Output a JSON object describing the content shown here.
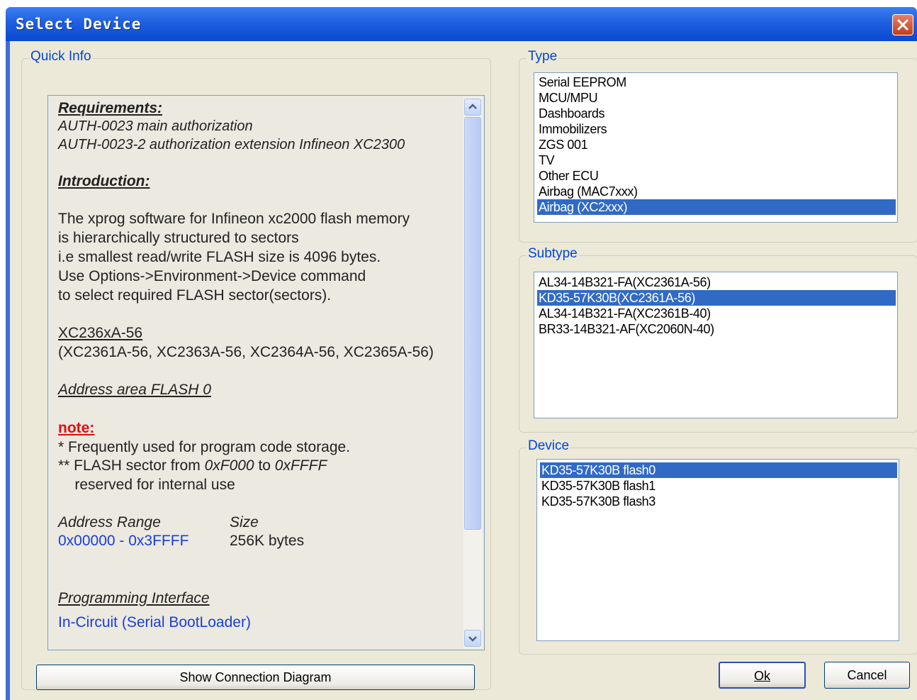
{
  "window": {
    "title": "Select Device"
  },
  "quick_info": {
    "group_label": "Quick Info",
    "requirements_heading": "Requirements:",
    "requirements": [
      "AUTH-0023  main authorization",
      "AUTH-0023-2 authorization extension Infineon XC2300"
    ],
    "introduction_heading": "Introduction:",
    "introduction_lines": [
      "The xprog software for Infineon xc2000 flash memory",
      "is hierarchically structured to sectors",
      "i.e smallest read/write FLASH size is 4096 bytes.",
      "Use Options->Environment->Device command",
      "to select required FLASH  sector(sectors)."
    ],
    "device_family": "XC236xA-56",
    "device_variants": "(XC2361A-56, XC2363A-56, XC2364A-56, XC2365A-56)",
    "address_area": "Address area FLASH 0",
    "note_label": "note:",
    "note_lines": [
      "* Frequently used for program code storage.",
      "** FLASH sector from ",
      "0xF000",
      " to ",
      "0xFFFF",
      "    reserved for internal use"
    ],
    "address_range_label": "Address Range",
    "size_label": "Size",
    "address_range_value": "0x00000 - 0x3FFFF",
    "size_value": "256K bytes",
    "programming_interface_label": "Programming Interface",
    "programming_interface_value": "In-Circuit (Serial BootLoader)"
  },
  "buttons": {
    "show_connection_diagram": "Show Connection Diagram",
    "ok": "Ok",
    "cancel": "Cancel"
  },
  "type": {
    "group_label": "Type",
    "items": [
      "Serial EEPROM",
      "MCU/MPU",
      "Dashboards",
      "Immobilizers",
      "ZGS 001",
      "TV",
      "Other ECU",
      "Airbag (MAC7xxx)",
      "Airbag (XC2xxx)"
    ],
    "selected_index": 8
  },
  "subtype": {
    "group_label": "Subtype",
    "items": [
      "AL34-14B321-FA(XC2361A-56)",
      "KD35-57K30B(XC2361A-56)",
      "AL34-14B321-FA(XC2361B-40)",
      "BR33-14B321-AF(XC2060N-40)"
    ],
    "selected_index": 1
  },
  "device": {
    "group_label": "Device",
    "items": [
      "KD35-57K30B flash0",
      "KD35-57K30B flash1",
      "KD35-57K30B flash3"
    ],
    "selected_index": 0
  }
}
